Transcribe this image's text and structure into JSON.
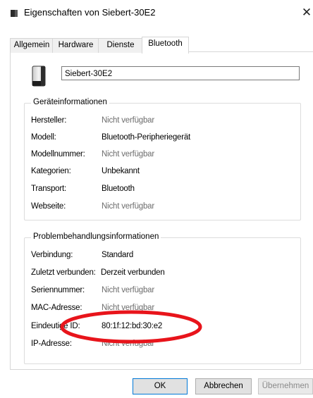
{
  "window": {
    "title": "Eigenschaften von Siebert-30E2",
    "close_glyph": "✕"
  },
  "tabs": [
    {
      "label": "Allgemein",
      "active": false
    },
    {
      "label": "Hardware",
      "active": false
    },
    {
      "label": "Dienste",
      "active": false
    },
    {
      "label": "Bluetooth",
      "active": true
    }
  ],
  "device": {
    "name": "Siebert-30E2",
    "icon": "speaker-device-icon"
  },
  "device_info": {
    "title": "Geräteinformationen",
    "rows": [
      {
        "label": "Hersteller:",
        "value": "Nicht verfügbar",
        "muted": true
      },
      {
        "label": "Modell:",
        "value": "Bluetooth-Peripheriegerät",
        "muted": false
      },
      {
        "label": "Modellnummer:",
        "value": "Nicht verfügbar",
        "muted": true
      },
      {
        "label": "Kategorien:",
        "value": "Unbekannt",
        "muted": false
      },
      {
        "label": "Transport:",
        "value": "Bluetooth",
        "muted": false
      },
      {
        "label": "Webseite:",
        "value": "Nicht verfügbar",
        "muted": true
      }
    ]
  },
  "troubleshooting": {
    "title": "Problembehandlungsinformationen",
    "rows": [
      {
        "label": "Verbindung:",
        "value": "Standard",
        "muted": false
      },
      {
        "label": "Zuletzt verbunden:",
        "value": "Derzeit verbunden",
        "muted": false
      },
      {
        "label": "Seriennummer:",
        "value": "Nicht verfügbar",
        "muted": true
      },
      {
        "label": "MAC-Adresse:",
        "value": "Nicht verfügbar",
        "muted": true
      },
      {
        "label": "Eindeutige ID:",
        "value": "80:1f:12:bd:30:e2",
        "muted": false
      },
      {
        "label": "IP-Adresse:",
        "value": "Nicht verfügbar",
        "muted": true
      }
    ]
  },
  "buttons": {
    "ok": "OK",
    "cancel": "Abbrechen",
    "apply": "Übernehmen"
  },
  "colors": {
    "highlight_ellipse": "#e8141b",
    "muted_text": "#6d6d6d",
    "focus_border": "#0078d7"
  }
}
